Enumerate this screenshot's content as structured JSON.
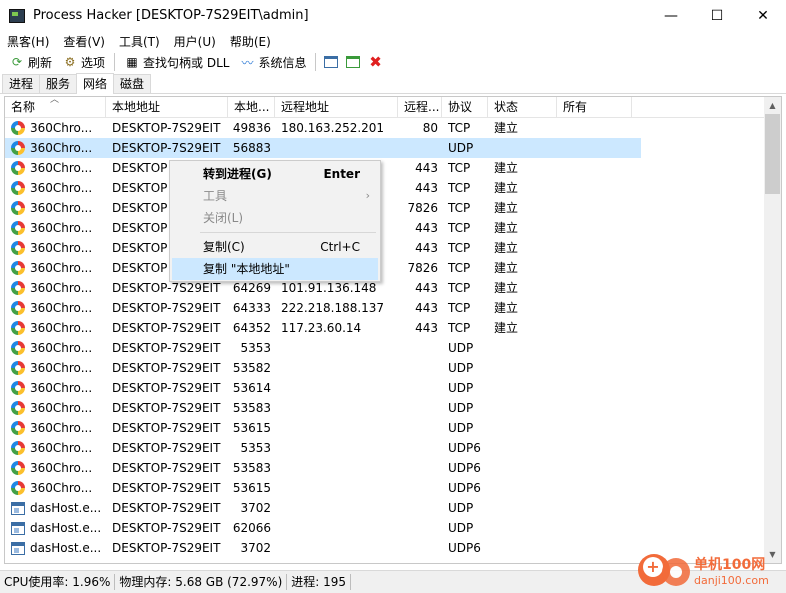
{
  "window": {
    "title": "Process Hacker [DESKTOP-7S29EIT\\admin]",
    "minimize": "—",
    "maximize": "☐",
    "close": "✕"
  },
  "menu": [
    "黑客(H)",
    "查看(V)",
    "工具(T)",
    "用户(U)",
    "帮助(E)"
  ],
  "toolbar": {
    "refresh": "刷新",
    "options": "选项",
    "find": "查找句柄或 DLL",
    "sysinfo": "系统信息"
  },
  "tabs": [
    "进程",
    "服务",
    "网络",
    "磁盘"
  ],
  "active_tab": "网络",
  "columns": [
    "名称",
    "本地地址",
    "本地...",
    "远程地址",
    "远程...",
    "协议",
    "状态",
    "所有"
  ],
  "rows": [
    {
      "icon": "360",
      "name": "360Chro...",
      "local": "DESKTOP-7S29EIT",
      "lport": "49836",
      "remote": "180.163.252.201",
      "rport": "80",
      "proto": "TCP",
      "state": "建立"
    },
    {
      "icon": "360",
      "name": "360Chro...",
      "local": "DESKTOP-7S29EIT",
      "lport": "56883",
      "remote": "",
      "rport": "",
      "proto": "UDP",
      "state": ""
    },
    {
      "icon": "360",
      "name": "360Chro...",
      "local": "DESKTOP",
      "lport": "",
      "remote": "",
      "rport": "443",
      "proto": "TCP",
      "state": "建立"
    },
    {
      "icon": "360",
      "name": "360Chro...",
      "local": "DESKTOP",
      "lport": "",
      "remote": "",
      "rport": "443",
      "proto": "TCP",
      "state": "建立"
    },
    {
      "icon": "360",
      "name": "360Chro...",
      "local": "DESKTOP",
      "lport": "",
      "remote": "",
      "rport": "7826",
      "proto": "TCP",
      "state": "建立"
    },
    {
      "icon": "360",
      "name": "360Chro...",
      "local": "DESKTOP",
      "lport": "",
      "remote": "",
      "rport": "443",
      "proto": "TCP",
      "state": "建立"
    },
    {
      "icon": "360",
      "name": "360Chro...",
      "local": "DESKTOP",
      "lport": "",
      "remote": "",
      "rport": "443",
      "proto": "TCP",
      "state": "建立"
    },
    {
      "icon": "360",
      "name": "360Chro...",
      "local": "DESKTOP",
      "lport": "",
      "remote": "",
      "rport": "7826",
      "proto": "TCP",
      "state": "建立"
    },
    {
      "icon": "360",
      "name": "360Chro...",
      "local": "DESKTOP-7S29EIT",
      "lport": "64269",
      "remote": "101.91.136.148",
      "rport": "443",
      "proto": "TCP",
      "state": "建立"
    },
    {
      "icon": "360",
      "name": "360Chro...",
      "local": "DESKTOP-7S29EIT",
      "lport": "64333",
      "remote": "222.218.188.137",
      "rport": "443",
      "proto": "TCP",
      "state": "建立"
    },
    {
      "icon": "360",
      "name": "360Chro...",
      "local": "DESKTOP-7S29EIT",
      "lport": "64352",
      "remote": "117.23.60.14",
      "rport": "443",
      "proto": "TCP",
      "state": "建立"
    },
    {
      "icon": "360",
      "name": "360Chro...",
      "local": "DESKTOP-7S29EIT",
      "lport": "5353",
      "remote": "",
      "rport": "",
      "proto": "UDP",
      "state": ""
    },
    {
      "icon": "360",
      "name": "360Chro...",
      "local": "DESKTOP-7S29EIT",
      "lport": "53582",
      "remote": "",
      "rport": "",
      "proto": "UDP",
      "state": ""
    },
    {
      "icon": "360",
      "name": "360Chro...",
      "local": "DESKTOP-7S29EIT",
      "lport": "53614",
      "remote": "",
      "rport": "",
      "proto": "UDP",
      "state": ""
    },
    {
      "icon": "360",
      "name": "360Chro...",
      "local": "DESKTOP-7S29EIT",
      "lport": "53583",
      "remote": "",
      "rport": "",
      "proto": "UDP",
      "state": ""
    },
    {
      "icon": "360",
      "name": "360Chro...",
      "local": "DESKTOP-7S29EIT",
      "lport": "53615",
      "remote": "",
      "rport": "",
      "proto": "UDP",
      "state": ""
    },
    {
      "icon": "360",
      "name": "360Chro...",
      "local": "DESKTOP-7S29EIT",
      "lport": "5353",
      "remote": "",
      "rport": "",
      "proto": "UDP6",
      "state": ""
    },
    {
      "icon": "360",
      "name": "360Chro...",
      "local": "DESKTOP-7S29EIT",
      "lport": "53583",
      "remote": "",
      "rport": "",
      "proto": "UDP6",
      "state": ""
    },
    {
      "icon": "360",
      "name": "360Chro...",
      "local": "DESKTOP-7S29EIT",
      "lport": "53615",
      "remote": "",
      "rport": "",
      "proto": "UDP6",
      "state": ""
    },
    {
      "icon": "win",
      "name": "dasHost.e...",
      "local": "DESKTOP-7S29EIT",
      "lport": "3702",
      "remote": "",
      "rport": "",
      "proto": "UDP",
      "state": ""
    },
    {
      "icon": "win",
      "name": "dasHost.e...",
      "local": "DESKTOP-7S29EIT",
      "lport": "62066",
      "remote": "",
      "rport": "",
      "proto": "UDP",
      "state": ""
    },
    {
      "icon": "win",
      "name": "dasHost.e...",
      "local": "DESKTOP-7S29EIT",
      "lport": "3702",
      "remote": "",
      "rport": "",
      "proto": "UDP6",
      "state": ""
    }
  ],
  "selected_row": 1,
  "context_menu": {
    "goto": "转到进程(G)",
    "goto_shortcut": "Enter",
    "tools": "工具",
    "close": "关闭(L)",
    "copy": "复制(C)",
    "copy_shortcut": "Ctrl+C",
    "copy_local": "复制 \"本地地址\""
  },
  "status": {
    "cpu": "CPU使用率: 1.96%",
    "mem": "物理内存: 5.68 GB (72.97%)",
    "proc": "进程: 195"
  },
  "watermark": {
    "title": "单机100网",
    "url": "danji100.com"
  },
  "colors": {
    "selection": "#cce8ff",
    "watermark": "#f26b3a"
  }
}
